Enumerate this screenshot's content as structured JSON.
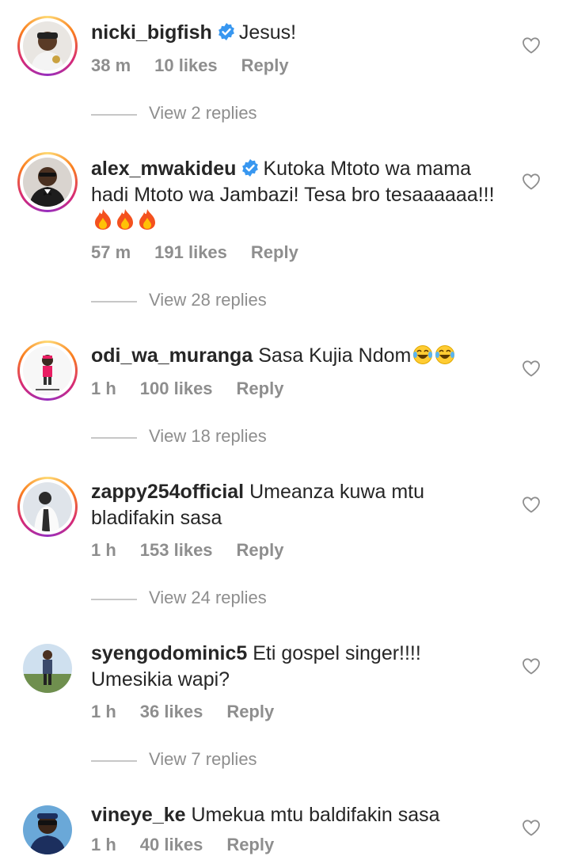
{
  "comments": [
    {
      "username": "nicki_bigfish",
      "verified": true,
      "text": "Jesus!",
      "time": "38 m",
      "likes": "10 likes",
      "reply": "Reply",
      "view_replies": "View 2 replies",
      "avatar_icon": "avatar-photo-icon"
    },
    {
      "username": "alex_mwakideu",
      "verified": true,
      "text": "Kutoka Mtoto wa mama hadi Mtoto wa Jambazi! Tesa bro tesaaaaaa!!!",
      "emoji": "fire-emoji x3",
      "time": "57 m",
      "likes": "191 likes",
      "reply": "Reply",
      "view_replies": "View 28 replies",
      "avatar_icon": "avatar-photo-icon"
    },
    {
      "username": "odi_wa_muranga",
      "verified": false,
      "text": "Sasa Kujia Ndom",
      "emoji": "laughing-tears-emoji x2",
      "time": "1 h",
      "likes": "100 likes",
      "reply": "Reply",
      "view_replies": "View 18 replies",
      "avatar_icon": "avatar-photo-icon"
    },
    {
      "username": "zappy254official",
      "verified": false,
      "text": "Umeanza kuwa mtu bladifakin sasa",
      "time": "1 h",
      "likes": "153 likes",
      "reply": "Reply",
      "view_replies": "View 24 replies",
      "avatar_icon": "avatar-photo-icon"
    },
    {
      "username": "syengodominic5",
      "verified": false,
      "text": "Eti gospel singer!!!! Umesikia wapi?",
      "time": "1 h",
      "likes": "36 likes",
      "reply": "Reply",
      "view_replies": "View 7 replies",
      "avatar_icon": "avatar-photo-icon"
    },
    {
      "username": "vineye_ke",
      "verified": false,
      "text": "Umekua mtu baldifakin sasa",
      "time": "1 h",
      "likes": "40 likes",
      "reply": "Reply",
      "avatar_icon": "avatar-photo-icon"
    }
  ],
  "colors": {
    "text": "#262626",
    "muted": "#8e8e8e",
    "verified_blue": "#3897f0",
    "divider": "#c7c7c7",
    "background": "#ffffff"
  }
}
